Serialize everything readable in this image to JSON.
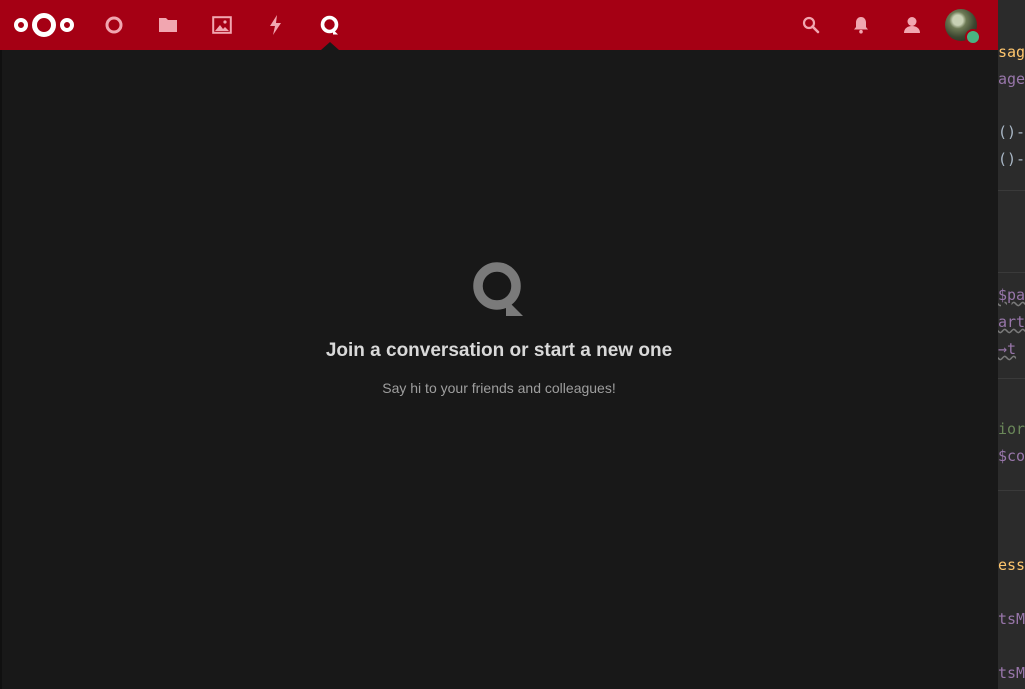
{
  "header": {
    "apps": [
      {
        "name": "nextcloud-logo"
      },
      {
        "name": "dashboard-icon"
      },
      {
        "name": "files-icon"
      },
      {
        "name": "photos-icon"
      },
      {
        "name": "activity-icon"
      },
      {
        "name": "talk-icon",
        "active": true
      }
    ],
    "right": [
      "search-icon",
      "notifications-icon",
      "contacts-icon",
      "avatar"
    ],
    "status": "online"
  },
  "empty_state": {
    "icon": "talk-icon",
    "title": "Join a conversation or start a new one",
    "subtitle": "Say hi to your friends and colleagues!"
  },
  "editor_fragments": [
    "sag",
    "age",
    "()-",
    "()-",
    "$pa",
    "art",
    "→t",
    "ior",
    "$co",
    "ess",
    "tsM",
    "tsM"
  ],
  "colors": {
    "header_bg": "#a50014",
    "app_bg": "#181818",
    "status_online": "#49b382",
    "editor_bg": "#2b2b2b"
  }
}
